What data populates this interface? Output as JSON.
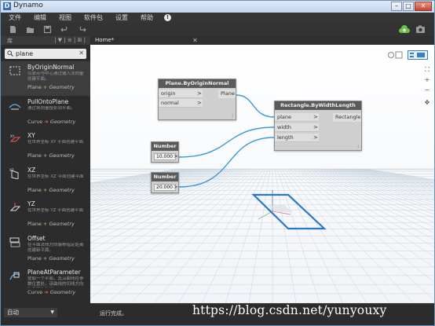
{
  "window": {
    "title": "Dynamo",
    "app_icon": "D"
  },
  "menu": [
    "文件",
    "编辑",
    "视图",
    "软件包",
    "设置",
    "帮助"
  ],
  "library": {
    "header_left": "库",
    "header_right": "| ▼ | ≡ | ⊞ |",
    "search": {
      "value": "plane",
      "placeholder": ""
    },
    "results": [
      {
        "name": "ByOriginNormal",
        "desc": "以原点与中心通过输入法向量创建平面。",
        "ret": "Plane",
        "kind": "plus",
        "type": "Geometry",
        "icon": "plane-origin-normal-icon"
      },
      {
        "name": "PullOntoPlane",
        "desc": "通过将向量投影到平面。",
        "ret": "Curve",
        "kind": "arrow",
        "type": "Geometry",
        "icon": "pull-onto-plane-icon"
      },
      {
        "name": "XY",
        "desc": "在世界坐标 XY 平面创建平面",
        "ret": "Plane",
        "kind": "plus",
        "type": "Geometry",
        "icon": "plane-xy-icon"
      },
      {
        "name": "XZ",
        "desc": "在世界坐标 XZ 平面创建平面",
        "ret": "Plane",
        "kind": "plus",
        "type": "Geometry",
        "icon": "plane-xz-icon"
      },
      {
        "name": "YZ",
        "desc": "在世界坐标 YZ 平面创建平面",
        "ret": "Plane",
        "kind": "plus",
        "type": "Geometry",
        "icon": "plane-yz-icon"
      },
      {
        "name": "Offset",
        "desc": "在平面法线方向偏移指定距离创建新平面。",
        "ret": "Plane",
        "kind": "plus",
        "type": "Geometry",
        "icon": "offset-plane-icon"
      },
      {
        "name": "PlaneAtParameter",
        "desc": "提取一个平面，其沿曲线在参数位置处，该曲线的切线方向为平面的法线。",
        "ret": "Curve",
        "kind": "arrow",
        "type": "Geometry",
        "icon": "plane-at-parameter-icon"
      }
    ],
    "run_mode": "自动"
  },
  "tabs": [
    {
      "label": "Home*"
    }
  ],
  "nodes": {
    "plane": {
      "title": "Plane.ByOriginNormal",
      "inputs": [
        "origin",
        "normal"
      ],
      "output": "Plane"
    },
    "rect": {
      "title": "Rectangle.ByWidthLength",
      "inputs": [
        "plane",
        "width",
        "length"
      ],
      "output": "Rectangle"
    },
    "num1": {
      "title": "Number",
      "value": "10.000"
    },
    "num2": {
      "title": "Number",
      "value": "20.000"
    }
  },
  "status": {
    "text": "运行完成。"
  },
  "watermark": "https://blog.csdn.net/yunyouxy",
  "colors": {
    "accent": "#3a7fc1",
    "rect_blue": "#2a79c2",
    "status_green": "#6cc04a"
  }
}
